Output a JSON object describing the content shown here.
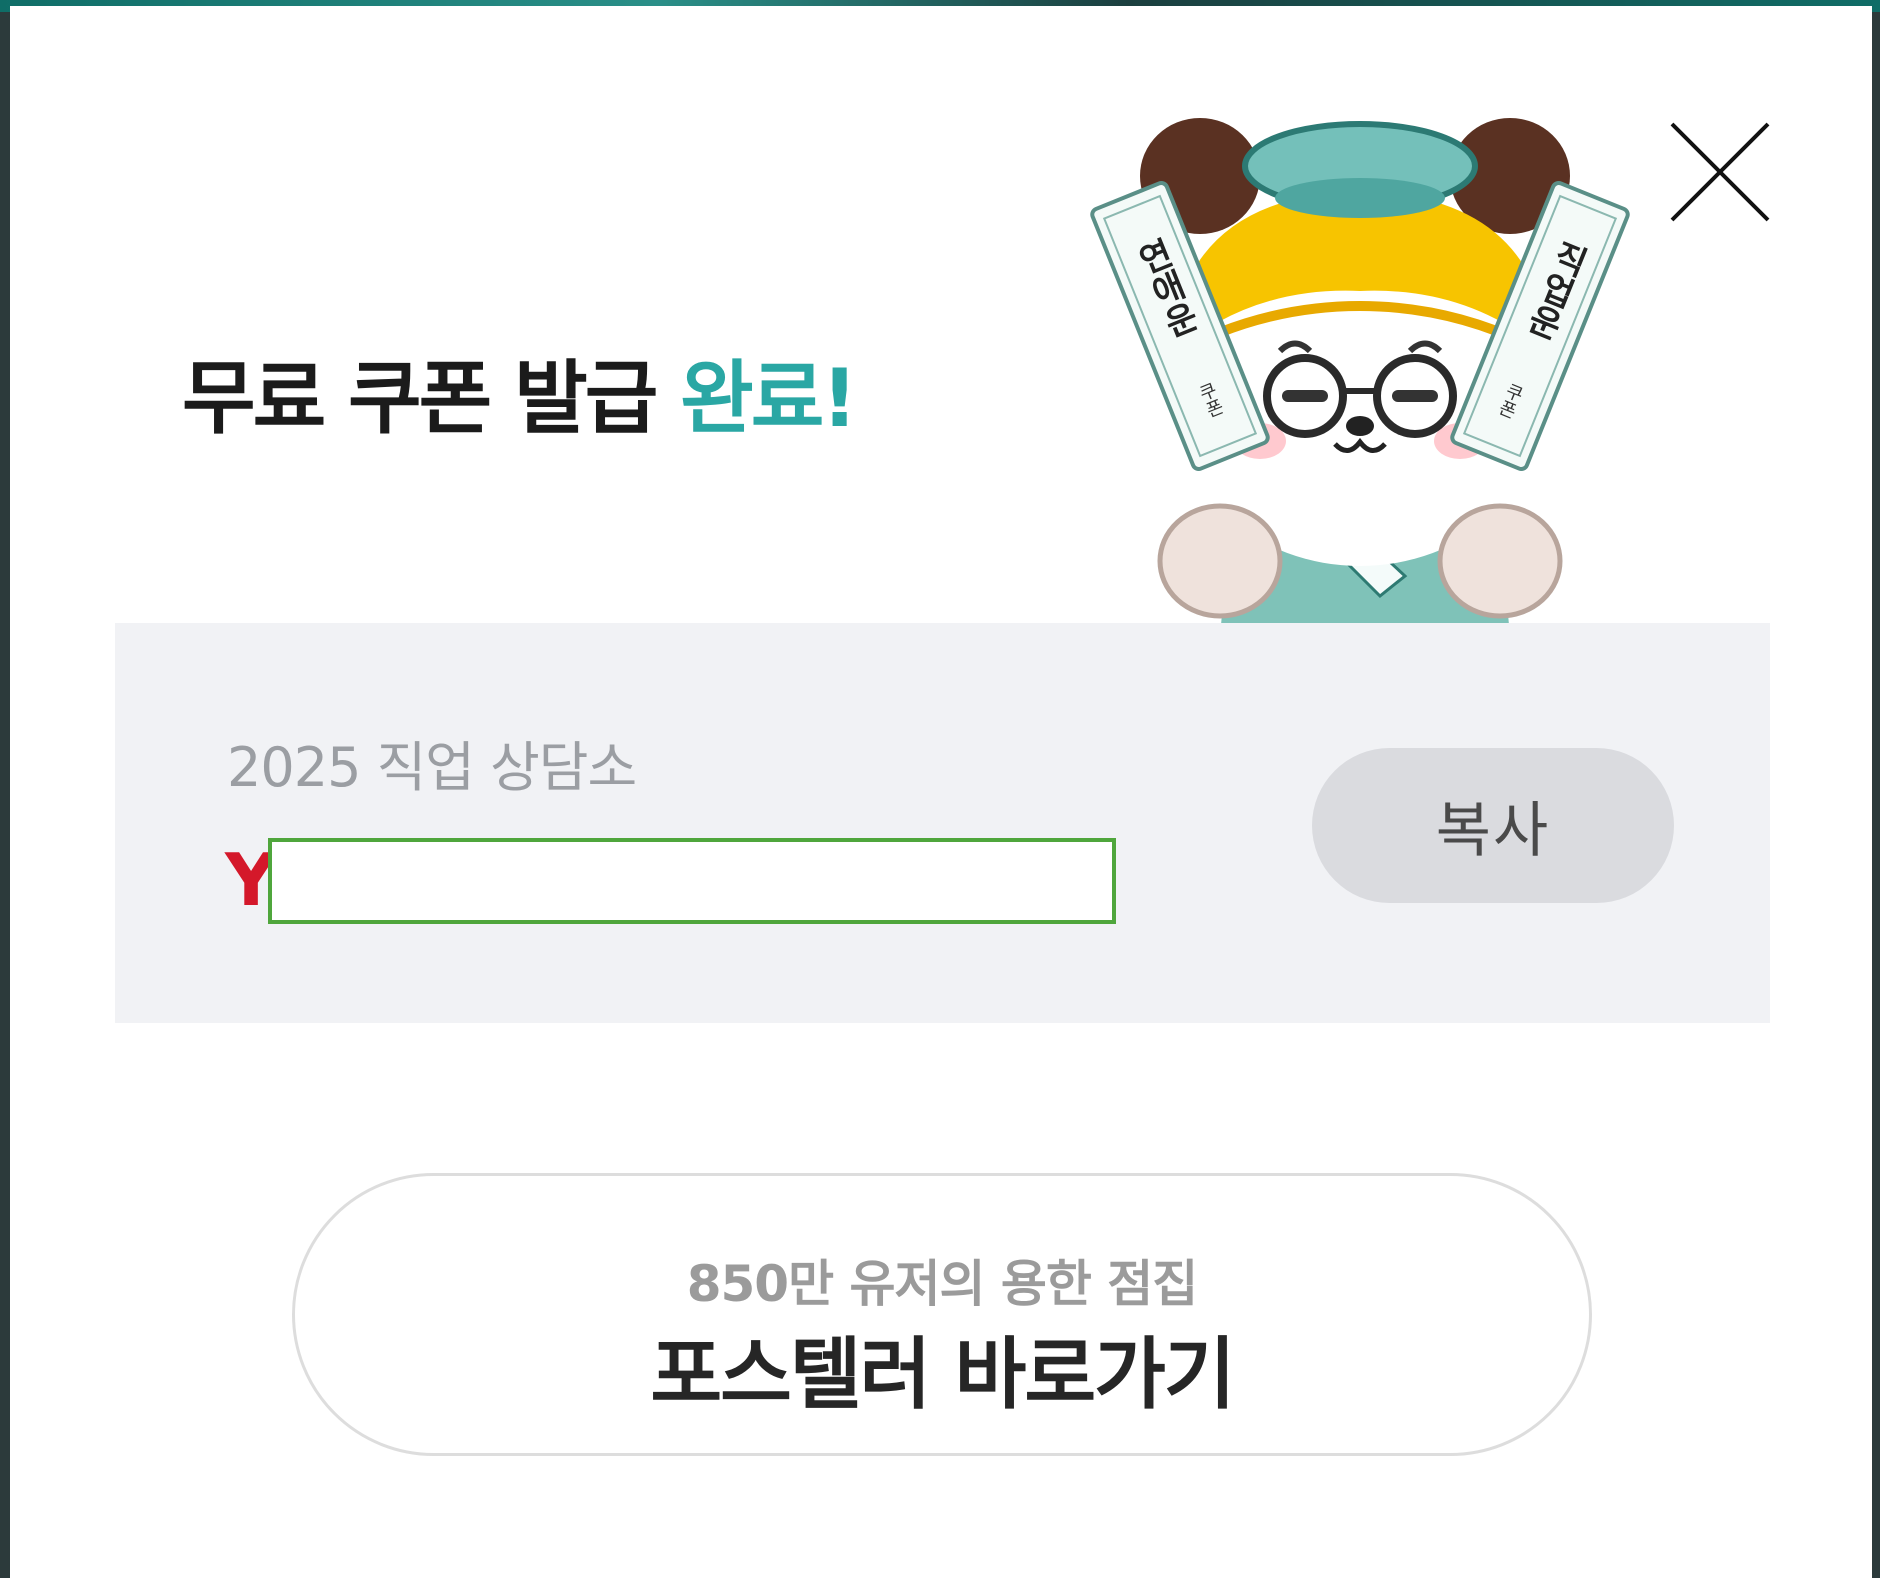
{
  "modal": {
    "title_main": "무료 쿠폰 발급",
    "title_accent": "완료!",
    "accent_color": "#2aa7a4",
    "close_icon": "close-icon",
    "character": {
      "left_ticket_text": "연애운",
      "left_ticket_sub": "쿠폰",
      "right_ticket_text": "직업운",
      "right_ticket_sub": "쿠폰"
    }
  },
  "coupon": {
    "label": "2025 직업 상담소",
    "code_prefix": "Y",
    "code_prefix_color": "#d4182a",
    "copy_label": "복사"
  },
  "cta": {
    "subtitle": "850만 유저의 용한 점집",
    "label": "포스텔러 바로가기"
  }
}
